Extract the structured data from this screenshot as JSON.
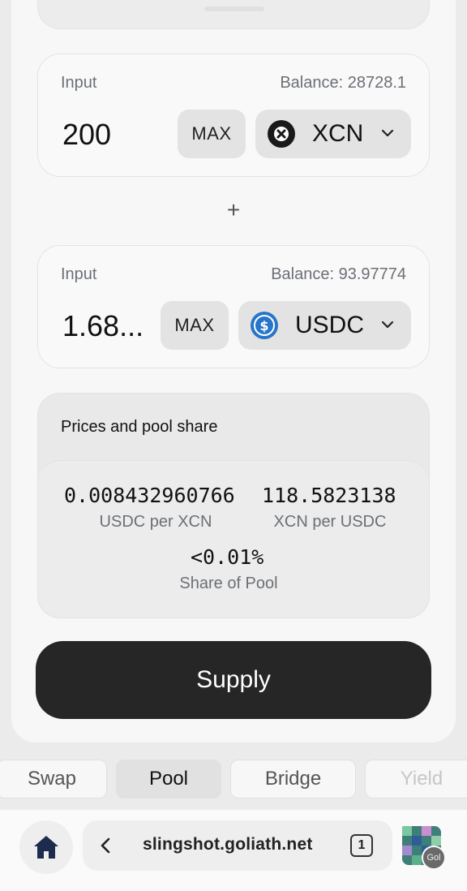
{
  "input_1": {
    "label": "Input",
    "balance": "Balance: 28728.1",
    "amount": "200",
    "max_label": "MAX",
    "token": "XCN",
    "token_icon": "xcn-token-icon"
  },
  "plus_sign": "+",
  "input_2": {
    "label": "Input",
    "balance": "Balance: 93.97774",
    "amount": "1.68...",
    "max_label": "MAX",
    "token": "USDC",
    "token_icon": "usdc-token-icon"
  },
  "prices": {
    "title": "Prices and pool share",
    "rate_1_value": "0.008432960766",
    "rate_1_label": "USDC per XCN",
    "rate_2_value": "118.5823138",
    "rate_2_label": "XCN per USDC",
    "share_value": "<0.01%",
    "share_label": "Share of Pool"
  },
  "supply_label": "Supply",
  "tabs": [
    {
      "label": "Swap",
      "active": false
    },
    {
      "label": "Pool",
      "active": true
    },
    {
      "label": "Bridge",
      "active": false
    },
    {
      "label": "Yield",
      "active": false
    }
  ],
  "browser": {
    "url": "slingshot.goliath.net",
    "tab_count": "1",
    "extension_badge": "Gol"
  },
  "colors": {
    "supply_button": "#262626",
    "usdc_blue": "#2775ca",
    "xcn_dark": "#1a1a1a"
  }
}
